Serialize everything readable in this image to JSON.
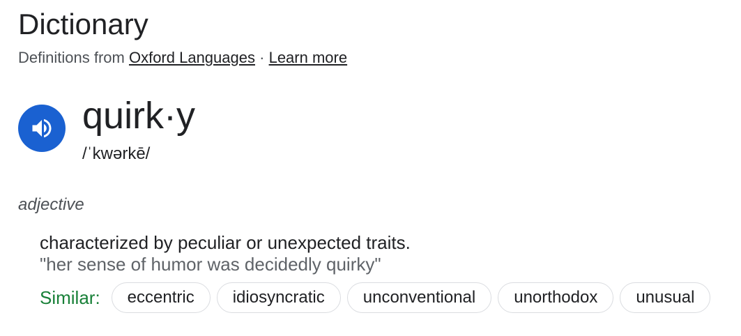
{
  "header": {
    "title": "Dictionary",
    "definitions_from_prefix": "Definitions from",
    "source_link": "Oxford Languages",
    "separator": "·",
    "learn_more": "Learn more"
  },
  "entry": {
    "speaker_icon": "volume-icon",
    "word": "quirk·y",
    "phonetic": "/ˈkwərkē/",
    "part_of_speech": "adjective",
    "definition": "characterized by peculiar or unexpected traits.",
    "example": "\"her sense of humor was decidedly quirky\"",
    "similar_label": "Similar:",
    "similar": [
      "eccentric",
      "idiosyncratic",
      "unconventional",
      "unorthodox",
      "unusual"
    ]
  },
  "colors": {
    "speaker_button": "#1a61d1",
    "similar_label": "#188038",
    "chip_border": "#dadce0"
  }
}
